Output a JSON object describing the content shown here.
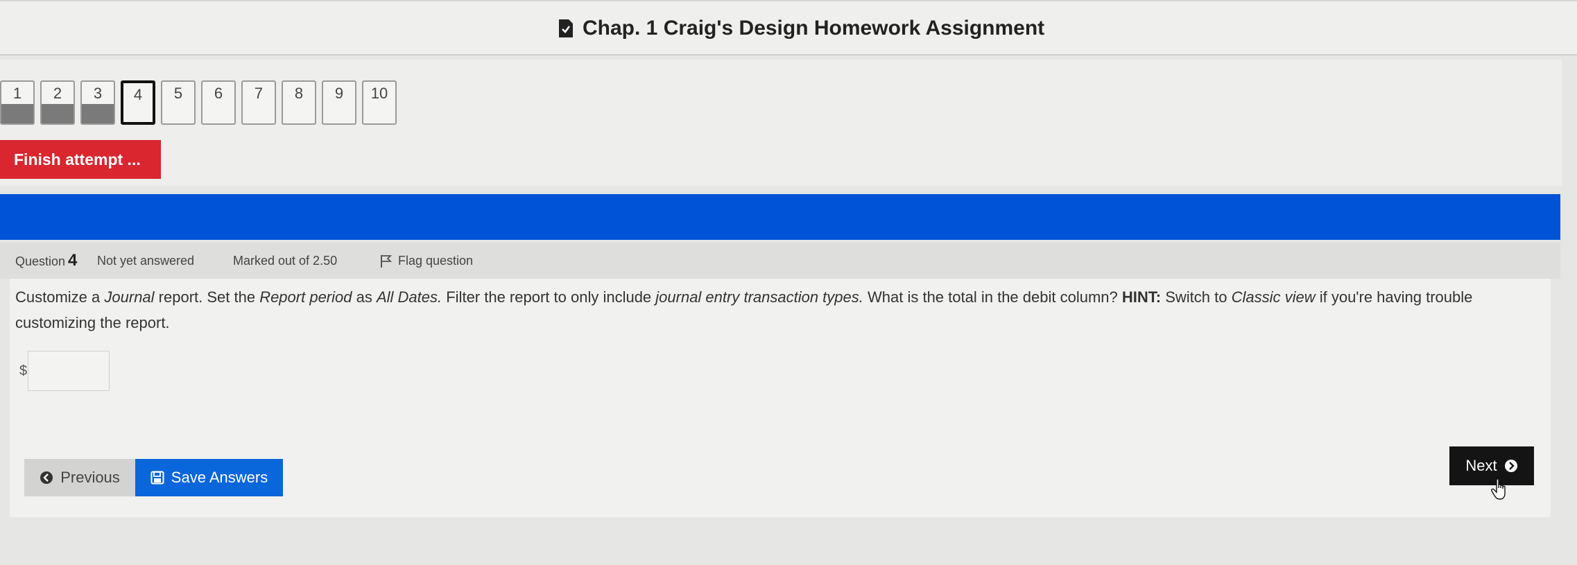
{
  "header": {
    "title": "Chap. 1 Craig's Design Homework Assignment",
    "icon": "document-check-icon"
  },
  "quiz_nav": {
    "buttons": [
      {
        "label": "1",
        "state": "saved"
      },
      {
        "label": "2",
        "state": "saved"
      },
      {
        "label": "3",
        "state": "saved"
      },
      {
        "label": "4",
        "state": "current"
      },
      {
        "label": "5",
        "state": "unanswered"
      },
      {
        "label": "6",
        "state": "unanswered"
      },
      {
        "label": "7",
        "state": "unanswered"
      },
      {
        "label": "8",
        "state": "unanswered"
      },
      {
        "label": "9",
        "state": "unanswered"
      },
      {
        "label": "10",
        "state": "unanswered"
      }
    ],
    "finish_label": "Finish attempt ..."
  },
  "question": {
    "label": "Question",
    "number": "4",
    "status": "Not yet answered",
    "marks": "Marked out of 2.50",
    "flag_label": "Flag question",
    "text": {
      "p1": "Customize a ",
      "i1": "Journal",
      "p2": " report.  Set the ",
      "i2": "Report period",
      "p3": " as ",
      "i3": "All Dates.",
      "p4": "  Filter the report to only include ",
      "i4": "journal entry transaction types.",
      "p5": "  What is the total in the debit column? ",
      "b1": "HINT:",
      "p6": " Switch to ",
      "i5": "Classic view",
      "p7": " if you're having trouble customizing the report."
    },
    "currency": "$",
    "answer_value": ""
  },
  "buttons": {
    "previous": "Previous",
    "save": "Save Answers",
    "next": "Next"
  },
  "colors": {
    "accent_blue": "#0053d6",
    "finish_red": "#d9262f",
    "save_blue": "#0a66db",
    "next_black": "#141414"
  }
}
